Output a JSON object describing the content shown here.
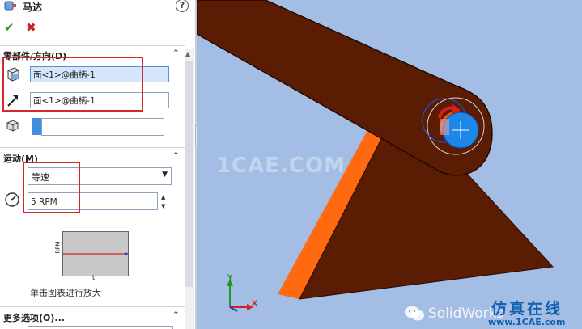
{
  "panel": {
    "title": "马达",
    "help": "?",
    "ok": "✔",
    "cancel": "✖",
    "component_section": {
      "label": "零部件/方向(D)",
      "face_ref": "面<1>@曲柄-1",
      "direction_ref": "面<1>@曲柄-1",
      "collapse": "⌃"
    },
    "motion_section": {
      "label": "运动(M)",
      "motion_type": "等速",
      "speed": "5 RPM",
      "graph_y_label": "RPM",
      "graph_x_label": "t",
      "zoom_hint": "单击图表进行放大",
      "collapse": "⌃"
    },
    "more_options": {
      "label": "更多选项(O)...",
      "collapse": "⌃"
    },
    "colors": {
      "red_highlight": "#d6282a",
      "selected_field": "#d5e6fb",
      "graph_line": "#cc2222"
    }
  },
  "viewport": {
    "watermark": "1CAE.COM",
    "brand_text": "SolidWorks",
    "brand_logo": "仿真在线",
    "brand_site": "www.1CAE.com",
    "triad": {
      "y": "Y",
      "x": "X"
    },
    "colors": {
      "background": "#a4bde4",
      "part_brown": "#5a1c02",
      "part_orange": "#ff6a10",
      "motor_blue": "#1c87e8",
      "motor_red": "#d8201a"
    }
  }
}
